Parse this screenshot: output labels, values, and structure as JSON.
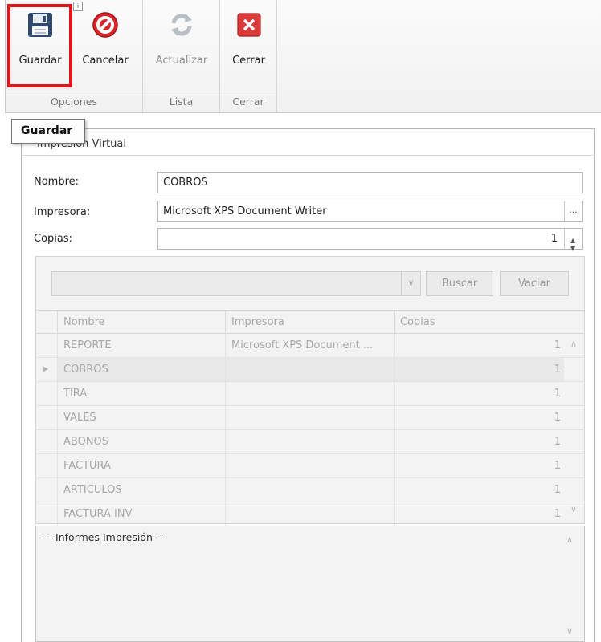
{
  "ribbon": {
    "groups": [
      {
        "label": "Opciones"
      },
      {
        "label": "Lista"
      },
      {
        "label": "Cerrar"
      }
    ],
    "buttons": {
      "save": "Guardar",
      "cancel": "Cancelar",
      "refresh": "Actualizar",
      "close": "Cerrar"
    }
  },
  "tooltip": {
    "text": "Guardar"
  },
  "panel": {
    "title": "Impresión Virtual"
  },
  "form": {
    "name_label": "Nombre:",
    "name_value": "COBROS",
    "printer_label": "Impresora:",
    "printer_value": "Microsoft XPS Document Writer",
    "copies_label": "Copias:",
    "copies_value": "1",
    "ellipsis": "..."
  },
  "search": {
    "search_button": "Buscar",
    "clear_button": "Vaciar"
  },
  "table": {
    "columns": [
      "Nombre",
      "Impresora",
      "Copias"
    ],
    "rows": [
      {
        "name": "REPORTE",
        "printer": "Microsoft XPS Document ...",
        "copies": "1"
      },
      {
        "name": "COBROS",
        "printer": "",
        "copies": "1"
      },
      {
        "name": "TIRA",
        "printer": "",
        "copies": "1"
      },
      {
        "name": "VALES",
        "printer": "",
        "copies": "1"
      },
      {
        "name": "ABONOS",
        "printer": "",
        "copies": "1"
      },
      {
        "name": "FACTURA",
        "printer": "",
        "copies": "1"
      },
      {
        "name": "ARTICULOS",
        "printer": "",
        "copies": "1"
      },
      {
        "name": "FACTURA INV",
        "printer": "",
        "copies": "1"
      }
    ]
  },
  "memo": {
    "text": "----Informes Impresión----"
  },
  "colors": {
    "highlight": "#e0141b",
    "cancel_red": "#d9262b",
    "close_red": "#d93a3a"
  }
}
